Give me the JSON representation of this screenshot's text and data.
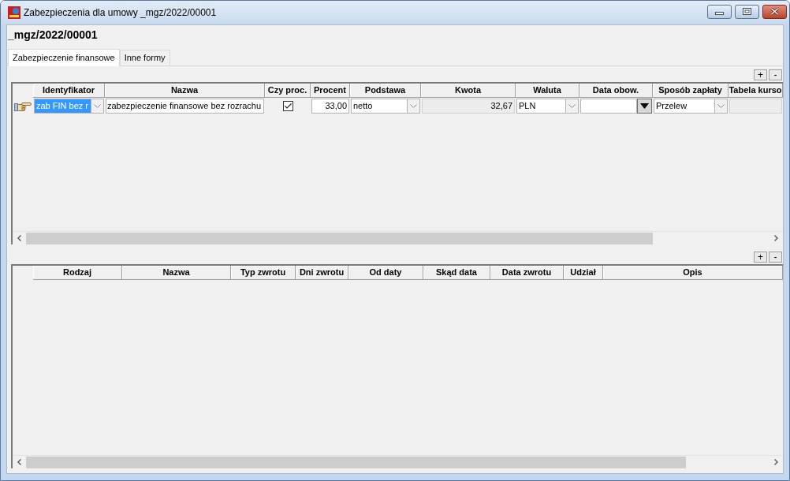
{
  "window": {
    "title": "Zabezpieczenia dla umowy _mgz/2022/00001"
  },
  "heading": "_mgz/2022/00001",
  "tabs": [
    {
      "label": "Zabezpieczenie finansowe",
      "selected": true
    },
    {
      "label": "Inne formy",
      "selected": false
    }
  ],
  "upper_grid": {
    "buttons": [
      "+",
      "-"
    ],
    "columns": [
      "Identyfikator",
      "Nazwa",
      "Czy proc.",
      "Procent",
      "Podstawa",
      "Kwota",
      "Waluta",
      "Data obow.",
      "Sposób zapłaty",
      "Tabela kurso"
    ],
    "rows": [
      {
        "current": true,
        "cells": [
          {
            "kind": "combo",
            "value": "zab FIN bez r",
            "highlighted": true
          },
          {
            "kind": "text",
            "value": "zabezpieczenie finansowe bez rozrachu"
          },
          {
            "kind": "checkbox",
            "checked": true
          },
          {
            "kind": "number",
            "value": "33,00"
          },
          {
            "kind": "combo",
            "value": "netto",
            "highlighted": false
          },
          {
            "kind": "readonly",
            "value": "32,67"
          },
          {
            "kind": "combo",
            "value": "PLN",
            "highlighted": false
          },
          {
            "kind": "date"
          },
          {
            "kind": "combo",
            "value": "Przelew",
            "highlighted": false
          },
          {
            "kind": "readonly"
          }
        ]
      }
    ]
  },
  "lower_grid": {
    "buttons": [
      "+",
      "-"
    ],
    "columns": [
      "Rodzaj",
      "Nazwa",
      "Typ zwrotu",
      "Dni zwrotu",
      "Od daty",
      "Skąd data",
      "Data zwrotu",
      "Udział",
      "Opis"
    ]
  }
}
